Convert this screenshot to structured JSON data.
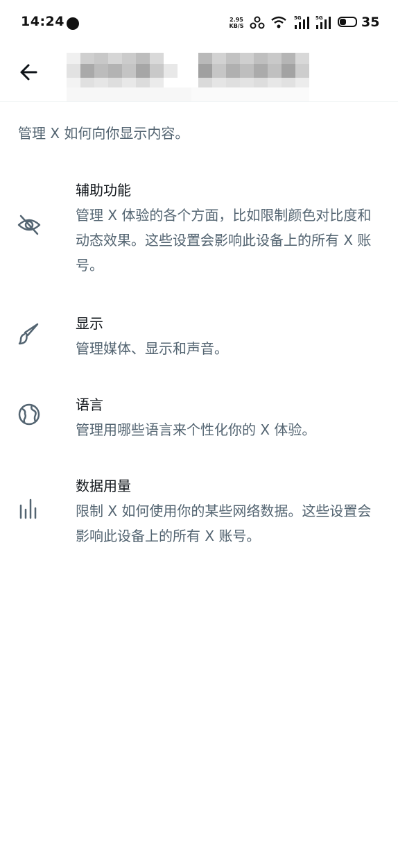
{
  "status_bar": {
    "time": "14:24",
    "net_speed_value": "2.95",
    "net_speed_unit": "KB/S",
    "signal_1_label": "5G",
    "signal_2_label": "5G",
    "battery": "35"
  },
  "header": {
    "back_icon": "arrow-left-icon"
  },
  "intro": "管理 X 如何向你显示内容。",
  "items": [
    {
      "title": "辅助功能",
      "description": "管理 X 体验的各个方面，比如限制颜色对比度和动态效果。这些设置会影响此设备上的所有 X 账号。",
      "icon": "eye-slash-icon"
    },
    {
      "title": "显示",
      "description": "管理媒体、显示和声音。",
      "icon": "brush-icon"
    },
    {
      "title": "语言",
      "description": "管理用哪些语言来个性化你的 X 体验。",
      "icon": "globe-icon"
    },
    {
      "title": "数据用量",
      "description": "限制 X 如何使用你的某些网络数据。这些设置会影响此设备上的所有 X 账号。",
      "icon": "bar-chart-icon"
    }
  ],
  "colors": {
    "primary_text": "#0f1419",
    "secondary_text": "#536471",
    "icon": "#536471"
  }
}
